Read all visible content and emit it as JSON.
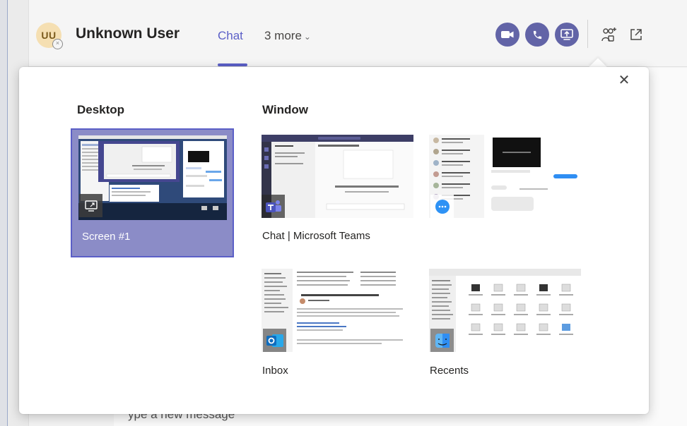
{
  "header": {
    "avatar_initials": "UU",
    "user_name": "Unknown User",
    "active_tab": "Chat",
    "more_tabs": "3 more",
    "accent_color": "#6264a7"
  },
  "background": {
    "partial_text": "ype a new message"
  },
  "share_panel": {
    "desktop_title": "Desktop",
    "window_title": "Window",
    "screen_label": "Screen #1",
    "windows": [
      {
        "label": "Chat | Microsoft Teams",
        "icon": "teams-icon"
      },
      {
        "label": "",
        "icon": "messages-icon"
      },
      {
        "label": "Inbox",
        "icon": "outlook-icon"
      },
      {
        "label": "Recents",
        "icon": "finder-icon"
      }
    ],
    "teams_thumb_text": "You're starting a new conversation",
    "close_icon": "close-icon"
  }
}
